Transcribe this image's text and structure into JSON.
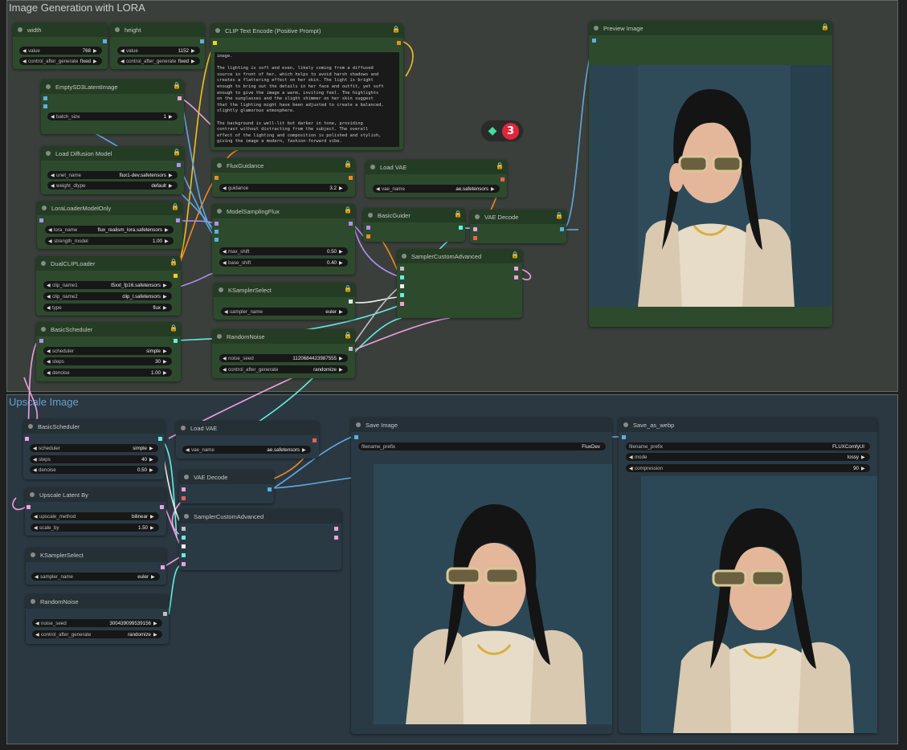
{
  "groups": [
    {
      "title": "Image Generation with LORA"
    },
    {
      "title": "Upscale Image"
    }
  ],
  "nodes": [
    {
      "title": "width",
      "widgets": [
        {
          "label": "value",
          "value": "768"
        },
        {
          "label": "control_after_generate",
          "value": "fixed"
        }
      ]
    },
    {
      "title": "height",
      "widgets": [
        {
          "label": "value",
          "value": "1152"
        },
        {
          "label": "control_after_generate",
          "value": "fixed"
        }
      ]
    },
    {
      "title": "EmptySD3LatentImage",
      "widgets": [
        {
          "label": "batch_size",
          "value": "1"
        }
      ]
    },
    {
      "title": "Load Diffusion Model",
      "widgets": [
        {
          "label": "unet_name",
          "value": "flux1-dev.safetensors"
        },
        {
          "label": "weight_dtype",
          "value": "default"
        }
      ]
    },
    {
      "title": "LoraLoaderModelOnly",
      "widgets": [
        {
          "label": "lora_name",
          "value": "flux_realism_lora.safetensors"
        },
        {
          "label": "strength_model",
          "value": "1.00"
        }
      ]
    },
    {
      "title": "DualCLIPLoader",
      "widgets": [
        {
          "label": "clip_name1",
          "value": "t5xxl_fp16.safetensors"
        },
        {
          "label": "clip_name2",
          "value": "clip_l.safetensors"
        },
        {
          "label": "type",
          "value": "flux"
        }
      ]
    },
    {
      "title": "BasicScheduler",
      "widgets": [
        {
          "label": "scheduler",
          "value": "simple"
        },
        {
          "label": "steps",
          "value": "30"
        },
        {
          "label": "denoise",
          "value": "1.00"
        }
      ]
    },
    {
      "title": "CLIP Text Encode (Positive Prompt)",
      "widgets": []
    },
    {
      "title": "FluxGuidance",
      "widgets": [
        {
          "label": "guidance",
          "value": "3.2"
        }
      ]
    },
    {
      "title": "ModelSamplingFlux",
      "widgets": [
        {
          "label": "max_shift",
          "value": "0.50"
        },
        {
          "label": "base_shift",
          "value": "0.40"
        }
      ]
    },
    {
      "title": "KSamplerSelect",
      "widgets": [
        {
          "label": "sampler_name",
          "value": "euler"
        }
      ]
    },
    {
      "title": "RandomNoise",
      "widgets": [
        {
          "label": "noise_seed",
          "value": "1120684423987555"
        },
        {
          "label": "control_after_generate",
          "value": "randomize"
        }
      ]
    },
    {
      "title": "Load VAE",
      "widgets": [
        {
          "label": "vae_name",
          "value": "ae.safetensors"
        }
      ]
    },
    {
      "title": "BasicGuider",
      "widgets": []
    },
    {
      "title": "VAE Decode",
      "widgets": []
    },
    {
      "title": "SamplerCustomAdvanced",
      "widgets": []
    },
    {
      "title": "Preview Image",
      "widgets": []
    },
    {
      "title": "BasicScheduler",
      "widgets": [
        {
          "label": "scheduler",
          "value": "simple"
        },
        {
          "label": "steps",
          "value": "40"
        },
        {
          "label": "denoise",
          "value": "0.50"
        }
      ]
    },
    {
      "title": "Load VAE",
      "widgets": [
        {
          "label": "vae_name",
          "value": "ae.safetensors"
        }
      ]
    },
    {
      "title": "Upscale Latent By",
      "widgets": [
        {
          "label": "upscale_method",
          "value": "bilinear"
        },
        {
          "label": "scale_by",
          "value": "1.50"
        }
      ]
    },
    {
      "title": "VAE Decode",
      "widgets": []
    },
    {
      "title": "SamplerCustomAdvanced",
      "widgets": []
    },
    {
      "title": "KSamplerSelect",
      "widgets": [
        {
          "label": "sampler_name",
          "value": "euler"
        }
      ]
    },
    {
      "title": "RandomNoise",
      "widgets": [
        {
          "label": "noise_seed",
          "value": "300439099539156"
        },
        {
          "label": "control_after_generate",
          "value": "randomize"
        }
      ]
    },
    {
      "title": "Save Image",
      "widgets": [
        {
          "label": "filename_prefix",
          "value": "FluxDev"
        }
      ]
    },
    {
      "title": "Save_as_webp",
      "widgets": [
        {
          "label": "filename_prefix",
          "value": "FLUXComfyUI"
        },
        {
          "label": "mode",
          "value": "lossy"
        },
        {
          "label": "compression",
          "value": "90"
        }
      ]
    }
  ],
  "prompt_text": "image.\n\nThe lighting is soft and even, likely coming from a diffused\nsource in front of her, which helps to avoid harsh shadows and\ncreates a flattering effect on her skin. The light is bright\nenough to bring out the details in her face and outfit, yet soft\nenough to give the image a warm, inviting feel. The highlights\non the sunglasses and the slight shimmer on her skin suggest\nthat the lighting might have been adjusted to create a balanced,\nslightly glamorous atmosphere.\n\nThe background is well-lit but darker in tone, providing\ncontrast without distracting from the subject. The overall\neffect of the lighting and composition is polished and stylish,\ngiving the image a modern, fashion-forward vibe.",
  "queue_badge": {
    "count": "3"
  },
  "colors": {
    "group1_bg": "#3a3f3b",
    "group2_bg": "#2b3841",
    "group1_title": "#c9cfc9",
    "group2_title": "#6aa0c8",
    "node_green": "#2d4a2d",
    "node_blue": "#2a3a44",
    "wire_yellow": "#f0c020",
    "wire_pink": "#f0a0e0",
    "wire_cyan": "#60f0e0",
    "wire_blue": "#60a8e0",
    "wire_orange": "#f08a20",
    "wire_purple": "#b090f0",
    "wire_gray": "#c0c0c0"
  },
  "icons": {
    "lock": "lock-icon",
    "queue": "gem-icon"
  }
}
